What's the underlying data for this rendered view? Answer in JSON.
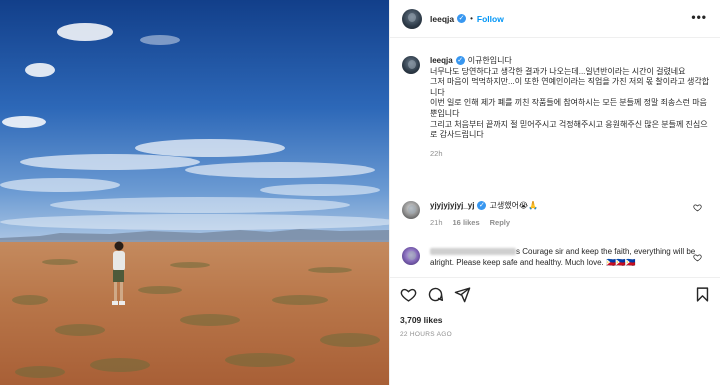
{
  "post": {
    "username": "leeqja",
    "follow_label": "Follow",
    "dot": "•",
    "more_label": "•••",
    "caption_username": "leeqja",
    "caption_text": "이규한입니다\n너무나도 당연하다고 생각한 결과가 나오는데...일년반이라는 시간이 걸렸네요\n그저 마음이 먹먹하지만...이 또한 연예인이라는 직업을 가진 저의 몫 찰이라고 생각합니다\n이번 일로 인해 제가 폐를 끼친 작품들에 참여하시는 모든 분들께 정말 죄송스런 마음뿐입니다\n그리고 처음부터 끝까지 절 믿어주시고 걱정해주시고 응원해주신 많은 분들께 진심으로 감사드립니다",
    "caption_time": "22h",
    "likes": "3,709 likes",
    "posted_ago": "22 HOURS AGO"
  },
  "comments": [
    {
      "username": "yjyjyjyjyj_yj",
      "text": "고생했어😭🙏",
      "time": "21h",
      "likes": "16 likes",
      "reply": "Reply"
    },
    {
      "username": "",
      "text": "s Courage sir and keep the faith, everything will be alright. Please keep safe and healthy. Much love. 🇵🇭🇵🇭🇵🇭"
    }
  ],
  "icons": {
    "heart": "heart-icon",
    "comment": "comment-icon",
    "share": "share-icon",
    "save": "bookmark-icon"
  },
  "colors": {
    "accent": "#0095f6",
    "verified": "#3897f0",
    "muted": "#8e8e8e",
    "sky_top": "#1f4f9c",
    "desert": "#b8734a"
  }
}
